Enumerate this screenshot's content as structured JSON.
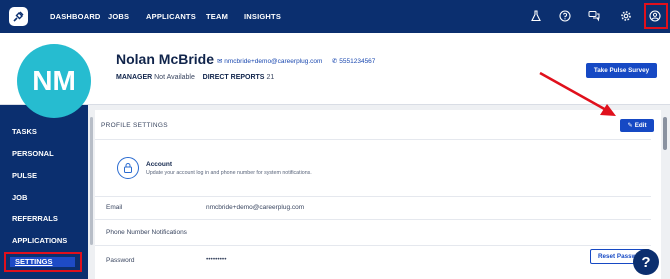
{
  "topnav": {
    "items": [
      "DASHBOARD",
      "JOBS",
      "APPLICANTS",
      "TEAM",
      "INSIGHTS"
    ],
    "icons": [
      "flask-icon",
      "help-circle-icon",
      "chat-icon",
      "gear-icon",
      "user-circle-icon"
    ]
  },
  "profile": {
    "initials": "NM",
    "name": "Nolan McBride",
    "email": "nmcbride+demo@careerplug.com",
    "phone": "5551234567",
    "manager_label": "MANAGER",
    "manager_value": "Not Available",
    "reports_label": "DIRECT REPORTS",
    "reports_value": "21",
    "pulse_button": "Take Pulse Survey"
  },
  "sidebar": {
    "items": [
      "TASKS",
      "PERSONAL",
      "PULSE",
      "JOB",
      "REFERRALS",
      "APPLICATIONS",
      "SETTINGS"
    ],
    "active": "SETTINGS"
  },
  "settings": {
    "title": "PROFILE SETTINGS",
    "edit_button": "Edit",
    "account_title": "Account",
    "account_desc": "Update your account log in and phone number for system notifications.",
    "rows": [
      {
        "label": "Email",
        "value": "nmcbride+demo@careerplug.com"
      },
      {
        "label": "Phone Number Notifications",
        "value": ""
      },
      {
        "label": "Password",
        "value": "•••••••••"
      }
    ],
    "reset_button": "Reset Password"
  },
  "help_button": "?",
  "colors": {
    "nav": "#0b2f6f",
    "accent": "#1649c4",
    "avatar": "#26bcd0",
    "highlight": "#e0101c"
  }
}
